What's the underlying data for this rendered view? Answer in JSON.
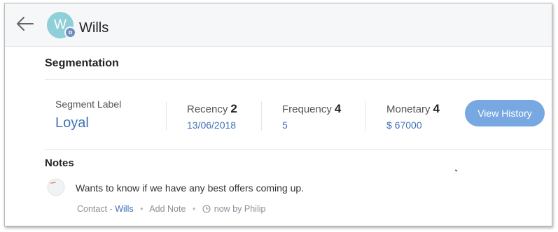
{
  "header": {
    "avatar_initial": "W",
    "avatar_badge": "o",
    "contact_name": "Wills"
  },
  "segmentation": {
    "title": "Segmentation",
    "segment_label_title": "Segment Label",
    "segment_label_value": "Loyal",
    "recency": {
      "label": "Recency",
      "score": "2",
      "value": "13/06/2018"
    },
    "frequency": {
      "label": "Frequency",
      "score": "4",
      "value": "5"
    },
    "monetary": {
      "label": "Monetary",
      "score": "4",
      "value": "$ 67000"
    },
    "view_history_label": "View History"
  },
  "notes": {
    "title": "Notes",
    "items": [
      {
        "text": "Wants to know if we have any best offers coming up.",
        "module": "Contact",
        "module_sep": "-",
        "record": "Wills",
        "dot": "•",
        "add_note": "Add Note",
        "time": "now",
        "by": "by",
        "author": "Philip"
      }
    ]
  },
  "colors": {
    "accent": "#3f72b5",
    "button": "#78a8e2",
    "avatar": "#8ecfd8",
    "header_bg": "#f6f7f8"
  },
  "icons": {
    "back": "arrow-left-icon",
    "note": "note-avatar-icon",
    "clock": "clock-icon"
  }
}
